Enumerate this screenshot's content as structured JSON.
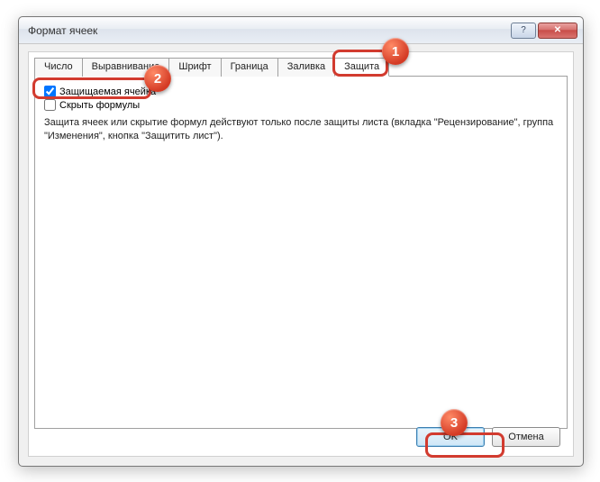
{
  "window": {
    "title": "Формат ячеек"
  },
  "tabs": [
    {
      "label": "Число"
    },
    {
      "label": "Выравнивание"
    },
    {
      "label": "Шрифт"
    },
    {
      "label": "Граница"
    },
    {
      "label": "Заливка"
    },
    {
      "label": "Защита"
    }
  ],
  "protection": {
    "locked_label": "Защищаемая ячейка",
    "locked_checked": true,
    "hidden_label": "Скрыть формулы",
    "hidden_checked": false,
    "description": "Защита ячеек или скрытие формул действуют только после защиты листа (вкладка \"Рецензирование\", группа \"Изменения\", кнопка \"Защитить лист\")."
  },
  "buttons": {
    "ok": "OK",
    "cancel": "Отмена"
  },
  "annotations": {
    "b1": "1",
    "b2": "2",
    "b3": "3"
  }
}
